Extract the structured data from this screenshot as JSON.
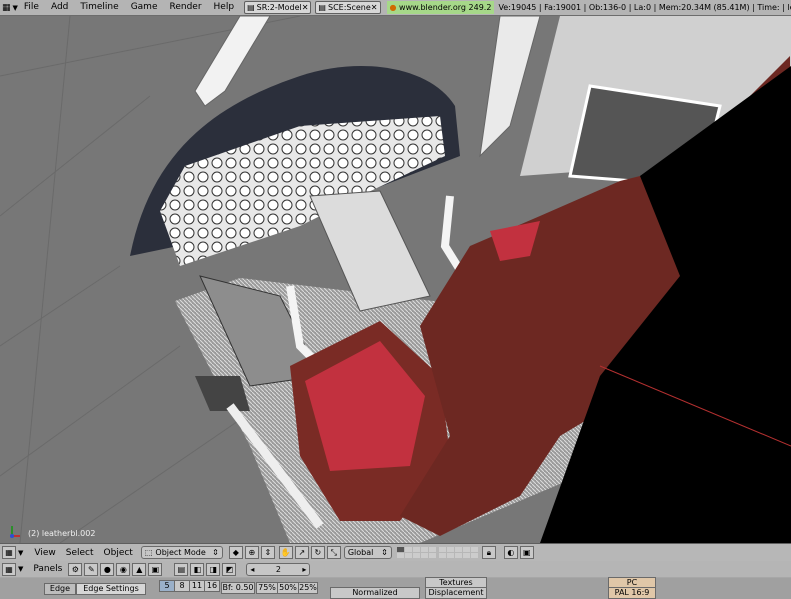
{
  "topbar": {
    "menus": [
      "File",
      "Add",
      "Timeline",
      "Game",
      "Render",
      "Help"
    ],
    "screen": "SR:2-Model",
    "scene": "SCE:Scene",
    "url": "www.blender.org 249.2",
    "stats": "Ve:19045 | Fa:19001 | Ob:136-0 | La:0  | Mem:20.34M (85.41M) | Time: | leathe"
  },
  "viewport": {
    "object_label": "(2) leatherbl.002"
  },
  "header": {
    "menus": [
      "View",
      "Select",
      "Object"
    ],
    "mode": "Object Mode",
    "orientation": "Global"
  },
  "panels": {
    "panels_label": "Panels",
    "frame": "2",
    "edge_tab": "Edge",
    "edge_settings": "Edge Settings",
    "nums": [
      "5",
      "8",
      "11",
      "16"
    ],
    "bf": "Bf: 0.50",
    "percents": [
      "75%",
      "50%",
      "25%"
    ],
    "normalized": "Normalized",
    "textures": "Textures",
    "displacement": "Displacement",
    "pc": "PC",
    "pal": "PAL 16:9"
  }
}
